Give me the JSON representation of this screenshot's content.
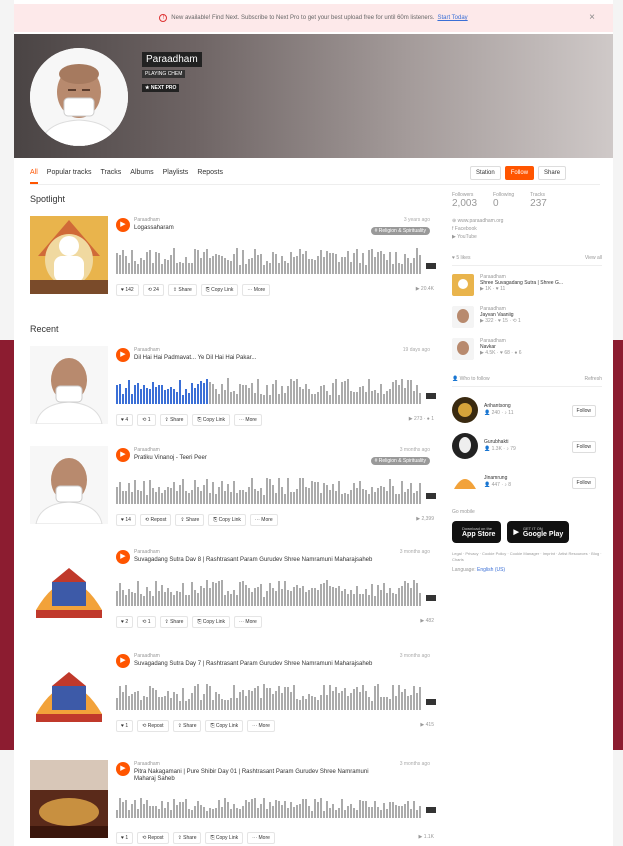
{
  "banner": {
    "text": "New available! Find Next. Subscribe to Next Pro to get your best upload free for until 60m listeners.",
    "link": "Start Today",
    "close": "×"
  },
  "profile": {
    "name": "Paraadham",
    "subtitle": "PLAYING CHEM",
    "badge": "★ NEXT PRO"
  },
  "tabs": [
    {
      "label": "All"
    },
    {
      "label": "Popular tracks"
    },
    {
      "label": "Tracks"
    },
    {
      "label": "Albums"
    },
    {
      "label": "Playlists"
    },
    {
      "label": "Reposts"
    }
  ],
  "actions": {
    "station": "Station",
    "follow": "Follow",
    "share": "Share"
  },
  "sections": {
    "spotlight": "Spotlight",
    "recent": "Recent"
  },
  "tracks": [
    {
      "user": "Paraadham",
      "title": "Logassaharam",
      "date": "3 years ago",
      "tag": "# Religion & Spirituality",
      "progress": 0,
      "buttons": [
        "♥ 142",
        "⟲ 24",
        "⇪ Share",
        "⎘ Copy Link",
        "⋯ More"
      ],
      "plays": "▶ 20.4K"
    },
    {
      "user": "Paraadham",
      "title": "Dil Hai Hai Padmavat... Ye Dil Hai Hai Pakar...",
      "date": "19 days ago",
      "tag": "",
      "progress": 0.3,
      "buttons": [
        "♥ 4",
        "⟲ 1",
        "⇪ Share",
        "⎘ Copy Link",
        "⋯ More"
      ],
      "plays": "▶ 273 · ● 1"
    },
    {
      "user": "Paraadham",
      "title": "Pratiku Vinanoj - Teeri Peer",
      "date": "3 months ago",
      "tag": "# Religion & Spirituality",
      "progress": 0,
      "buttons": [
        "♥ 14",
        "⟲ Repost",
        "⇪ Share",
        "⎘ Copy Link",
        "⋯ More"
      ],
      "plays": "▶ 2,399"
    },
    {
      "user": "Paraadham",
      "title": "Suvagadang Sutra Dav 8 | Rashtrasant Param Gurudev Shree Namramuni Maharajsaheb",
      "date": "3 months ago",
      "tag": "",
      "progress": 0,
      "buttons": [
        "♥ 2",
        "⟲ 1",
        "⇪ Share",
        "⎘ Copy Link",
        "⋯ More"
      ],
      "plays": "▶ 482"
    },
    {
      "user": "Paraadham",
      "title": "Suvagadang Sutra Day 7 | Rashtrasant Param Gurudev Shree Namramuni Maharajsaheb",
      "date": "3 months ago",
      "tag": "",
      "progress": 0,
      "buttons": [
        "♥ 1",
        "⟲ Repost",
        "⇪ Share",
        "⎘ Copy Link",
        "⋯ More"
      ],
      "plays": "▶ 415"
    },
    {
      "user": "Paraadham",
      "title": "Pitra Nakagamani | Pure Shibir Day 01 | Rashtrasant Param Gurudev Shree Namramuni Maharaj Saheb",
      "date": "3 months ago",
      "tag": "",
      "progress": 0,
      "buttons": [
        "♥ 1",
        "⟲ Repost",
        "⇪ Share",
        "⎘ Copy Link",
        "⋯ More"
      ],
      "plays": "▶ 1.1K"
    }
  ],
  "stats": [
    {
      "label": "Followers",
      "value": "2,003"
    },
    {
      "label": "Following",
      "value": "0"
    },
    {
      "label": "Tracks",
      "value": "237"
    }
  ],
  "links": [
    "⊕ www.paraadham.org",
    "f Facebook",
    "▶ YouTube"
  ],
  "likes": {
    "header": "♥ 5 likes",
    "viewall": "View all",
    "items": [
      {
        "user": "Paraadham",
        "title": "Shree Suvagadang Sutra | Shree G...",
        "stats": "▶ 1K · ♥ 11"
      },
      {
        "user": "Paraadham",
        "title": "Jayvan Vaaniig",
        "stats": "▶ 322 · ♥ 15 · ⟲ 1"
      },
      {
        "user": "Paraadham",
        "title": "Navkar",
        "stats": "▶ 4.5K · ♥ 68 · ● 6"
      }
    ]
  },
  "follow": {
    "header": "👤 Who to follow",
    "refresh": "Refresh",
    "items": [
      {
        "name": "Arihantsong",
        "stats": "👤 240 · ♪ 11",
        "button": "Follow"
      },
      {
        "name": "Gurubhakti",
        "stats": "👤 1.3K · ♪ 79",
        "button": "Follow"
      },
      {
        "name": "Jinamrung",
        "stats": "👤 447 · ♪ 8",
        "button": "Follow"
      }
    ]
  },
  "mobile": {
    "label": "Go mobile",
    "appstore_small": "Download on the",
    "appstore": "App Store",
    "google_small": "GET IT ON",
    "google": "Google Play"
  },
  "legal": "Legal · Privacy · Cookie Policy · Cookie Manager · Imprint · Artist Resources · Blog · Charts",
  "language": {
    "label": "Language:",
    "value": "English (US)"
  },
  "colors": {
    "accent": "#ff5500",
    "band": "#8c1c30",
    "waveform": "#ababab"
  }
}
